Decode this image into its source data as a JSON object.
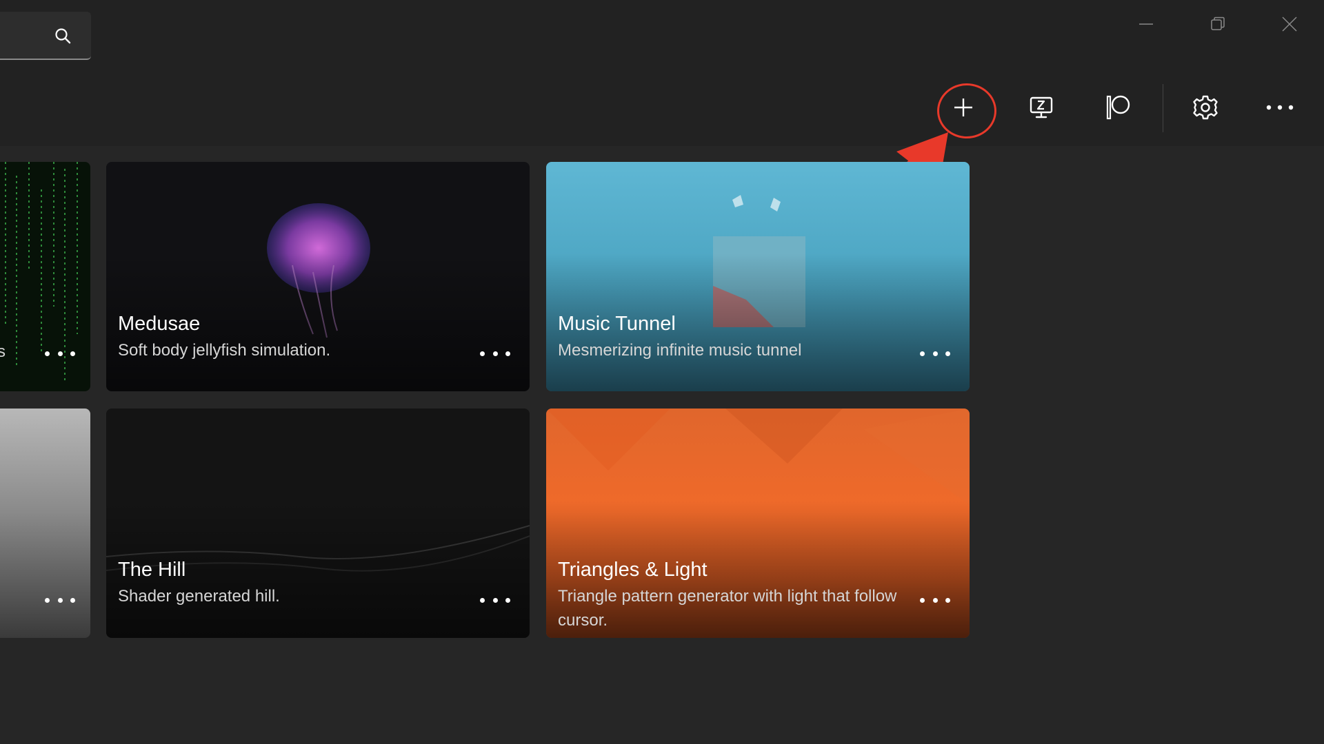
{
  "search": {
    "placeholder": "",
    "icon": "search-icon"
  },
  "window_controls": [
    {
      "name": "minimize-button",
      "icon": "minimize-icon"
    },
    {
      "name": "restore-button",
      "icon": "restore-icon"
    },
    {
      "name": "close-button",
      "icon": "close-icon"
    }
  ],
  "toolbar": {
    "buttons": [
      {
        "name": "add-wallpaper-button",
        "icon": "plus-icon"
      },
      {
        "name": "screensaver-button",
        "icon": "monitor-z-icon"
      },
      {
        "name": "patreon-button",
        "icon": "patreon-icon"
      },
      {
        "name": "settings-button",
        "icon": "gear-icon"
      },
      {
        "name": "more-button",
        "icon": "more-horizontal-icon"
      }
    ],
    "highlight_color": "#e8392a"
  },
  "cards": [
    {
      "title": "Medusae",
      "description": "Soft body jellyfish simulation."
    },
    {
      "title": "Music Tunnel",
      "description": "Mesmerizing infinite music tunnel"
    },
    {
      "title": "The Hill",
      "description": "Shader generated hill."
    },
    {
      "title": "Triangles & Light",
      "description": "Triangle pattern generator with light that follow cursor."
    }
  ],
  "partial_cards": [
    {
      "title_fragment": "s"
    },
    {
      "title_fragment": ""
    }
  ],
  "colors": {
    "background": "#262626",
    "bar": "#222222",
    "accent_arrow": "#e8392a",
    "orange_card": "#e8632a",
    "blue_card": "#5ab0cc"
  }
}
